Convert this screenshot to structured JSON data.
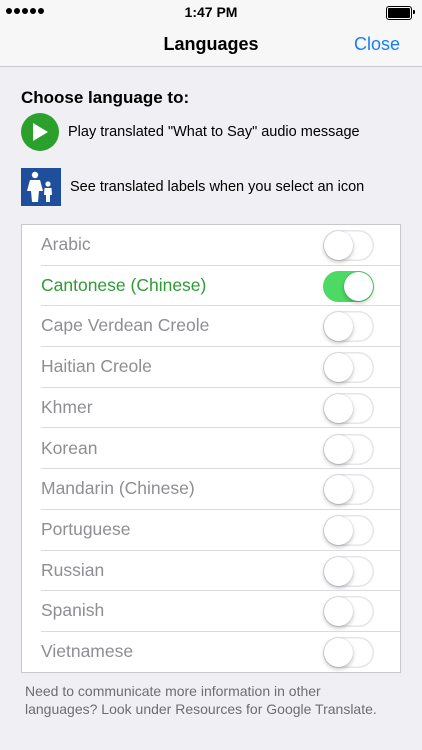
{
  "status_bar": {
    "time": "1:47 PM"
  },
  "nav": {
    "title": "Languages",
    "close_label": "Close"
  },
  "heading": "Choose language to:",
  "info": [
    {
      "icon": "play-icon",
      "text": "Play translated \"What to Say\" audio message"
    },
    {
      "icon": "family-icon",
      "text": "See translated labels when you select an icon"
    }
  ],
  "languages": [
    {
      "label": "Arabic",
      "selected": false
    },
    {
      "label": "Cantonese (Chinese)",
      "selected": true
    },
    {
      "label": "Cape Verdean Creole",
      "selected": false
    },
    {
      "label": "Haitian Creole",
      "selected": false
    },
    {
      "label": "Khmer",
      "selected": false
    },
    {
      "label": "Korean",
      "selected": false
    },
    {
      "label": "Mandarin (Chinese)",
      "selected": false
    },
    {
      "label": "Portuguese",
      "selected": false
    },
    {
      "label": "Russian",
      "selected": false
    },
    {
      "label": "Spanish",
      "selected": false
    },
    {
      "label": "Vietnamese",
      "selected": false
    }
  ],
  "footer": "Need to communicate more information in other languages? Look under Resources for Google Translate.",
  "colors": {
    "accent": "#1a7ef2",
    "toggle_on": "#4cd964",
    "selected_text": "#2e9b34",
    "play_green": "#2ca02c",
    "family_blue": "#1f4e9c"
  }
}
